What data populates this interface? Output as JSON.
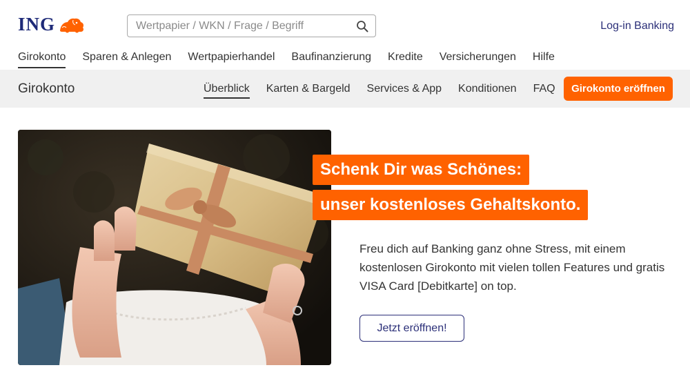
{
  "header": {
    "logo_text": "ING",
    "search": {
      "placeholder": "Wertpapier / WKN / Frage / Begriff",
      "value": ""
    },
    "login_label": "Log-in Banking"
  },
  "main_nav": {
    "items": [
      {
        "label": "Girokonto",
        "active": true
      },
      {
        "label": "Sparen & Anlegen"
      },
      {
        "label": "Wertpapierhandel"
      },
      {
        "label": "Baufinanzierung"
      },
      {
        "label": "Kredite"
      },
      {
        "label": "Versicherungen"
      },
      {
        "label": "Hilfe"
      }
    ]
  },
  "sub_bar": {
    "title": "Girokonto",
    "items": [
      {
        "label": "Überblick",
        "active": true
      },
      {
        "label": "Karten & Bargeld"
      },
      {
        "label": "Services & App"
      },
      {
        "label": "Konditionen"
      },
      {
        "label": "FAQ"
      }
    ],
    "cta_label": "Girokonto eröffnen"
  },
  "hero": {
    "headline_line1": "Schenk Dir was Schönes:",
    "headline_line2": "unser kostenloses Gehaltskonto.",
    "description": "Freu dich auf Banking ganz ohne Stress, mit einem kostenlosen Girokonto mit vielen tollen Features und gratis VISA Card [Debitkarte] on top.",
    "button_label": "Jetzt eröffnen!"
  },
  "colors": {
    "brand_orange": "#ff6200",
    "brand_navy": "#1e2a78",
    "link_navy": "#2b2f78",
    "subbar_bg": "#f0f0f0"
  },
  "icons": {
    "logo": "ing-lion-icon",
    "search": "search-icon"
  }
}
